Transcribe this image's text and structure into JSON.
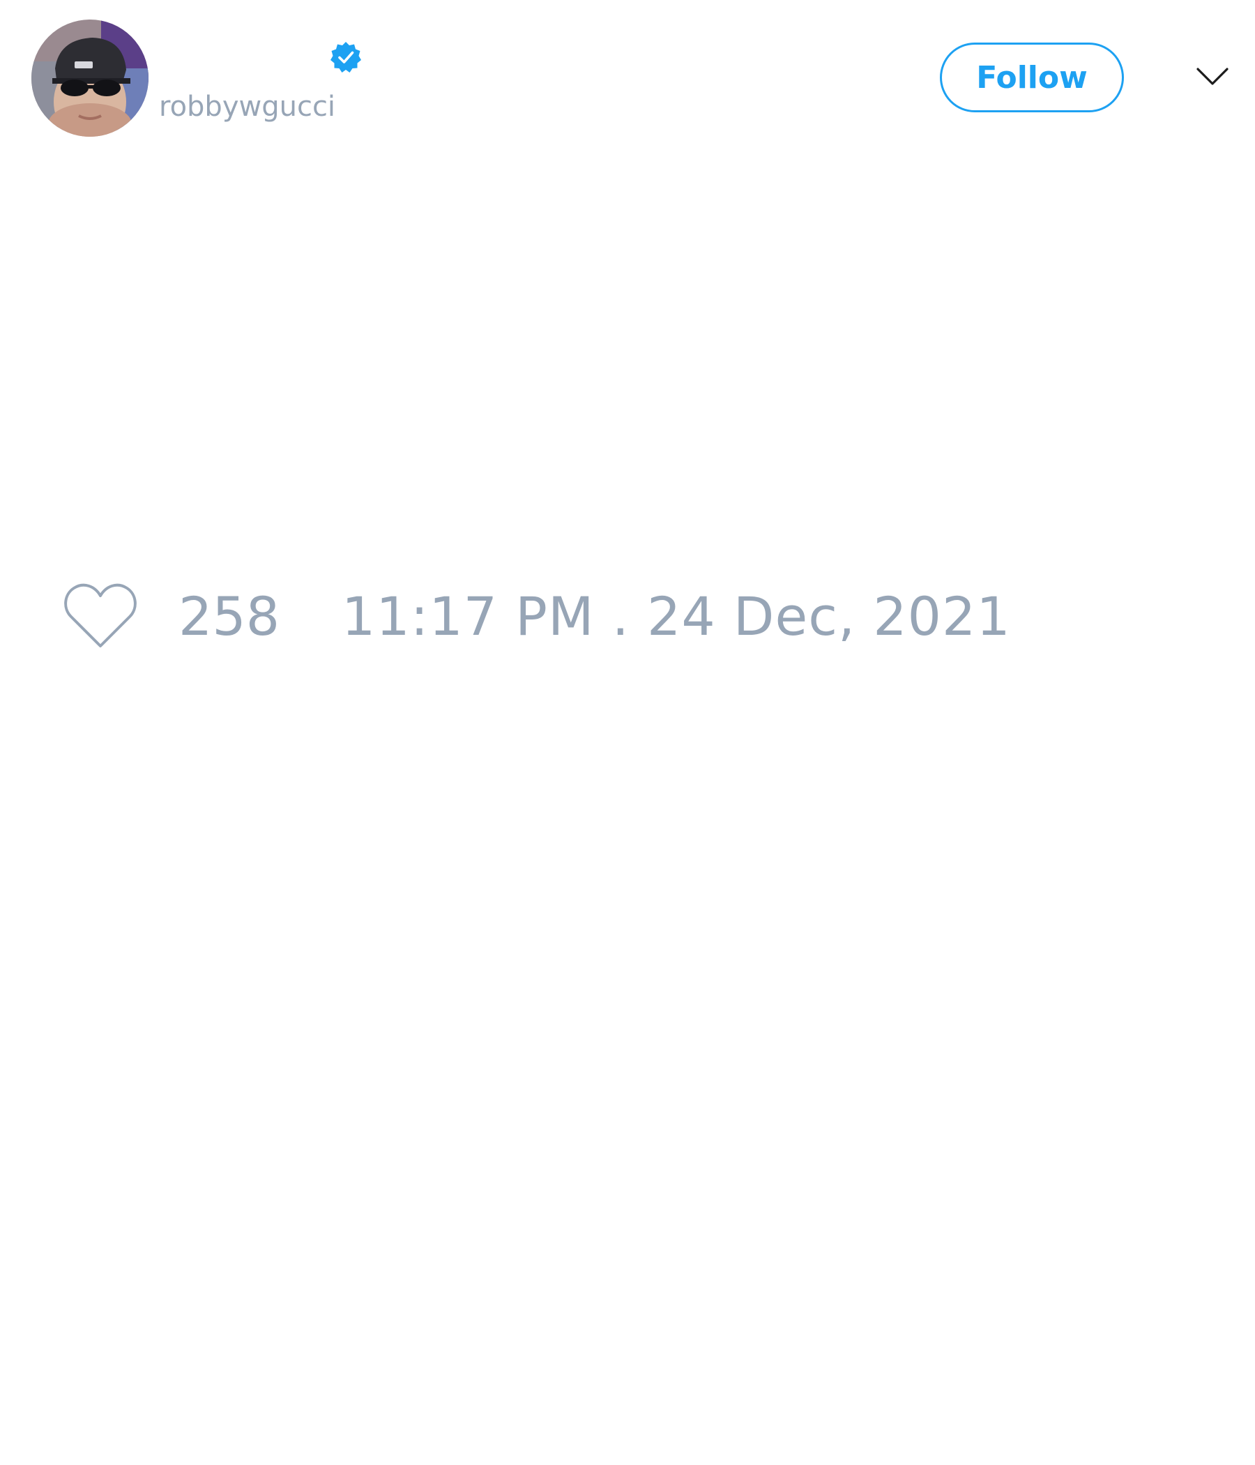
{
  "tweet": {
    "author": {
      "display_name": "",
      "username": "robbywgucci",
      "verified": true,
      "avatar_icon": "profile-photo-avatar"
    },
    "actions": {
      "follow_label": "Follow",
      "menu_icon": "chevron-down-icon"
    },
    "footer": {
      "like_icon": "heart-outline-icon",
      "like_count": "258",
      "timestamp": "11:17 PM . 24 Dec, 2021"
    }
  },
  "colors": {
    "accent": "#1da1f2",
    "muted_text": "#97a5b6",
    "background": "#ffffff"
  }
}
